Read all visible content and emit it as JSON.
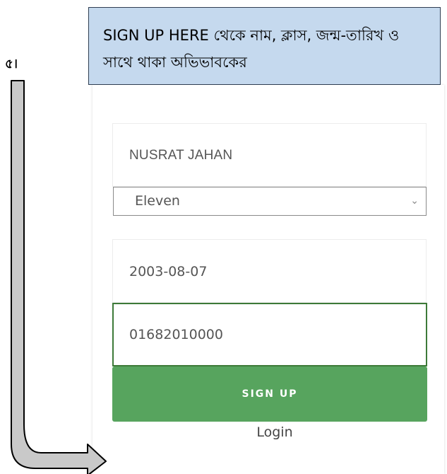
{
  "step": {
    "number": "৫।"
  },
  "callout": {
    "text": "SIGN UP HERE থেকে নাম, ক্লাস, জন্ম-তারিখ ও সাথে থাকা অভিভাবকের"
  },
  "form": {
    "name_value": "NUSRAT JAHAN",
    "class_selected": "Eleven",
    "dob_value": "2003-08-07",
    "phone_value": "01682010000",
    "signup_label": "SIGN UP",
    "login_label": "Login"
  },
  "colors": {
    "callout_bg": "#c5d9ee",
    "button_green": "#57a45e",
    "focus_border": "#3d7a38",
    "arrow_fill": "#c9c9c9"
  },
  "icons": {
    "select_chevron": "chevron-down-icon",
    "arrow": "arrow-right-icon"
  }
}
